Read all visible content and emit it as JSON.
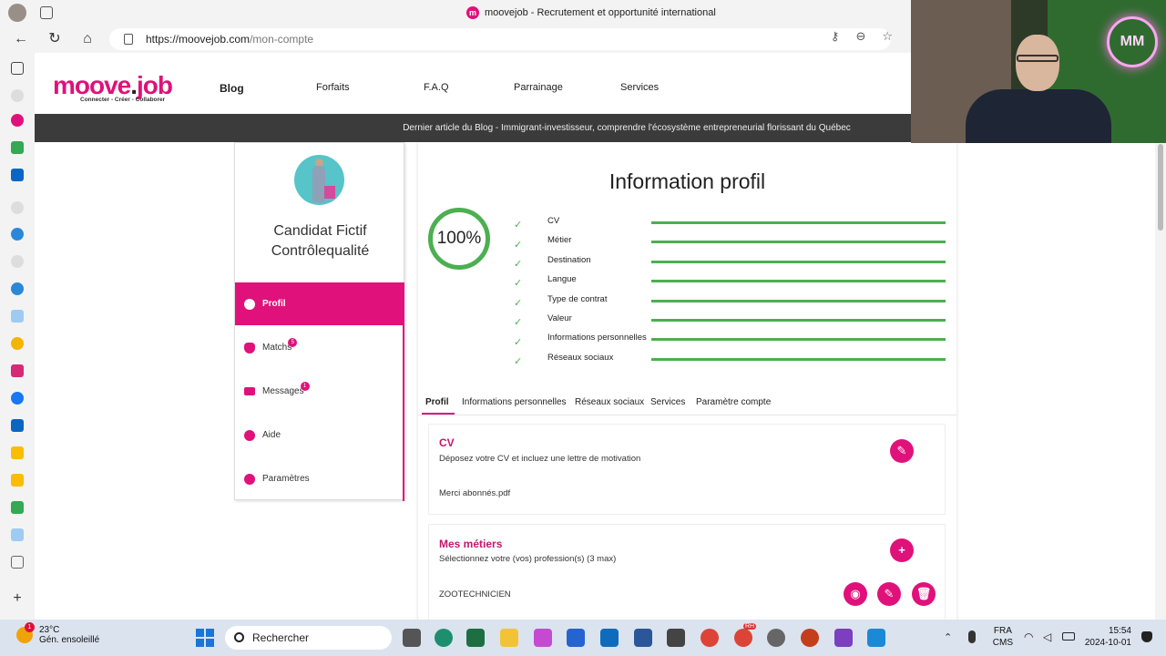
{
  "browser": {
    "title": "moovejob - Recrutement et opportunité international",
    "favicon": "m",
    "url_host": "https://moovejob.com",
    "url_path": "/mon-compte"
  },
  "site": {
    "logo_main_a": "moove",
    "logo_main_b": "job",
    "logo_tagline": "Connecter - Créer - Collaborer",
    "nav": [
      "Blog",
      "Forfaits",
      "F.A.Q",
      "Parrainage",
      "Services"
    ],
    "blog_banner": "Dernier article du Blog - Immigrant-investisseur, comprendre l'écosystème entrepreneurial florissant du Québec"
  },
  "profile_card": {
    "name_line1": "Candidat Fictif",
    "name_line2": "Contrôlequalité",
    "menu": [
      {
        "label": "Profil",
        "badge": ""
      },
      {
        "label": "Matchs",
        "badge": "5"
      },
      {
        "label": "Messages",
        "badge": "1"
      },
      {
        "label": "Aide",
        "badge": ""
      },
      {
        "label": "Paramètres",
        "badge": ""
      }
    ]
  },
  "info_profil": {
    "title": "Information profil",
    "percent": "100%",
    "items": [
      {
        "label": "CV",
        "progress": 1.0
      },
      {
        "label": "Métier",
        "progress": 1.0
      },
      {
        "label": "Destination",
        "progress": 1.0
      },
      {
        "label": "Langue",
        "progress": 1.0
      },
      {
        "label": "Type de contrat",
        "progress": 1.0
      },
      {
        "label": "Valeur",
        "progress": 1.0
      },
      {
        "label": "Informations personnelles",
        "progress": 1.0
      },
      {
        "label": "Réseaux sociaux",
        "progress": 1.0
      }
    ],
    "tabs": [
      "Profil",
      "Informations personnelles",
      "Réseaux sociaux",
      "Services",
      "Paramètre compte"
    ]
  },
  "sections": {
    "cv": {
      "title": "CV",
      "subtitle": "Déposez votre CV et incluez une lettre de motivation",
      "file": "Merci abonnés.pdf"
    },
    "metiers": {
      "title": "Mes métiers",
      "subtitle": "Sélectionnez votre (vos) profession(s) (3 max)",
      "item": "ZOOTECHNICIEN"
    }
  },
  "webcam": {
    "neon_text": "MM"
  },
  "taskbar": {
    "weather_temp": "23°C",
    "weather_desc": "Gén. ensoleillé",
    "weather_badge": "1",
    "search_placeholder": "Rechercher",
    "lang_line1": "FRA",
    "lang_line2": "CMS",
    "time": "15:54",
    "date": "2024-10-01",
    "badge_rh": "RH"
  },
  "colors": {
    "brand": "#e0117a",
    "success": "#4caf50",
    "banner": "#3b3b3b"
  }
}
